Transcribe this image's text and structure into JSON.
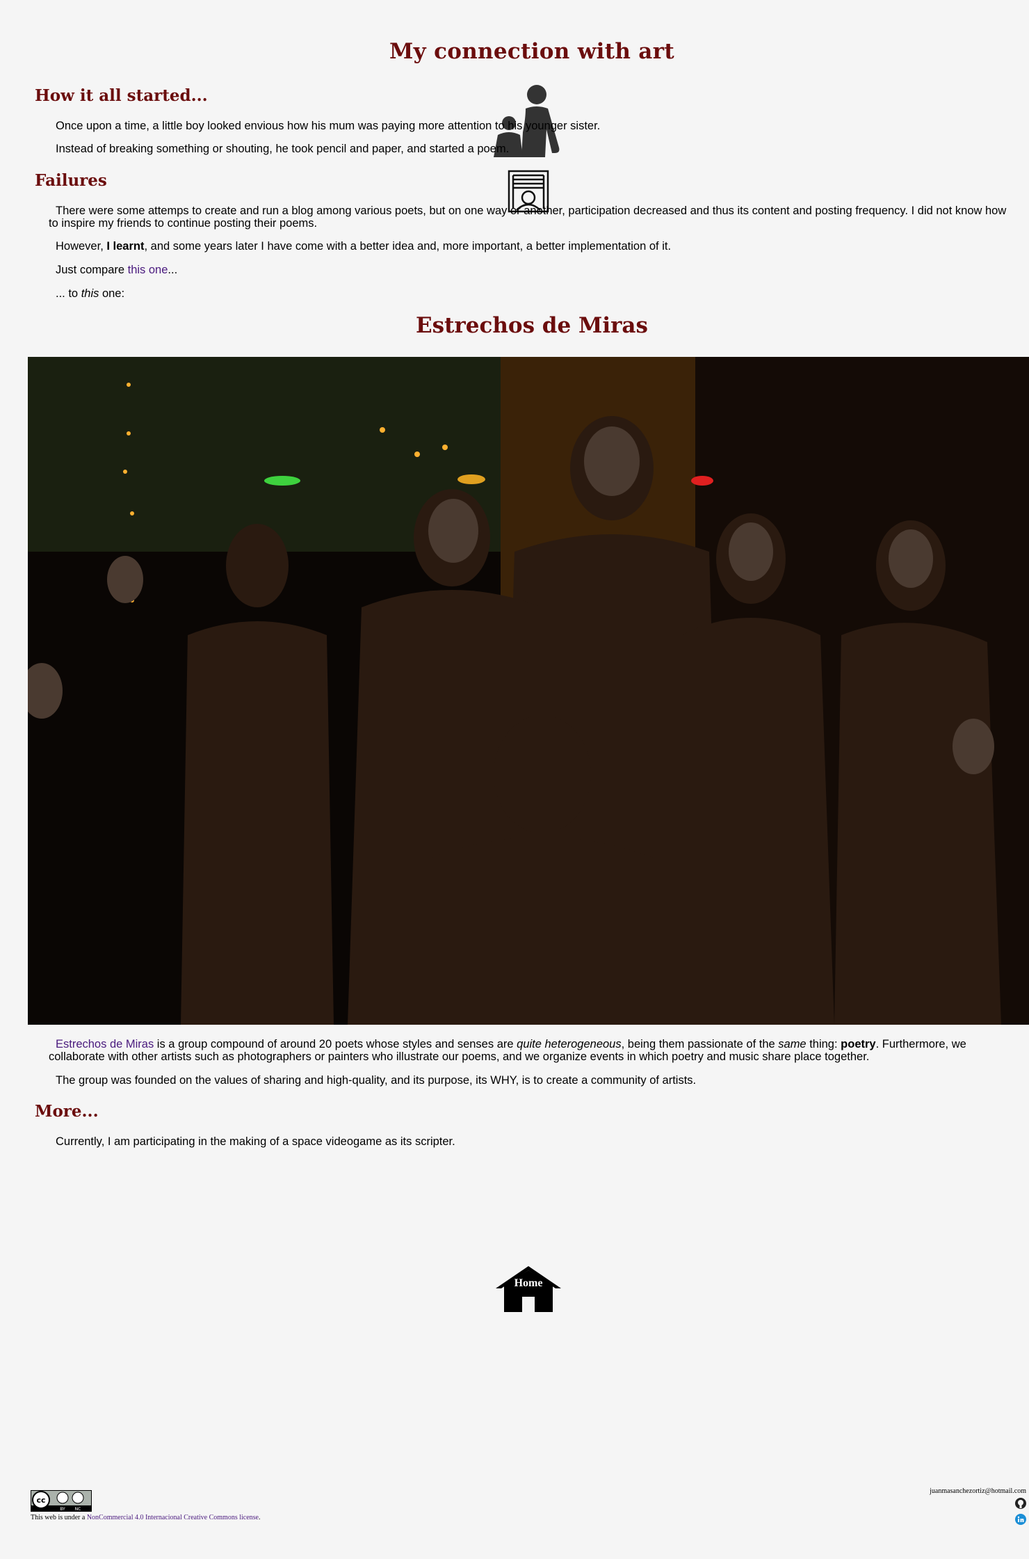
{
  "title": "My connection with art",
  "sections": {
    "started": {
      "heading": "How it all started...",
      "p1": "Once upon a time, a little boy looked envious how his mum was paying more attention to his younger sister.",
      "p2": "Instead of breaking something or shouting, he took pencil and paper, and started a poem."
    },
    "failures": {
      "heading": "Failures",
      "p1": "There were some attemps to create and run a blog among various poets, but on one way or another, participation decreased and thus its content and posting frequency. I did not know how to inspire my friends to continue posting their poems.",
      "p2_a": "However, ",
      "p2_bold": "I learnt",
      "p2_b": ", and some years later I have come with a better idea and, more important, a better implementation of it.",
      "p3_a": "Just compare ",
      "p3_link": "this one",
      "p3_b": "...",
      "p4_a": "... to ",
      "p4_em": "this",
      "p4_b": " one:"
    },
    "estrechos": {
      "heading": "Estrechos de Miras",
      "p1_link": "Estrechos de Miras",
      "p1_a": " is a group compound of around 20 poets whose styles and senses are ",
      "p1_em1": "quite heterogeneous",
      "p1_b": ", being them passionate of the ",
      "p1_em2": "same",
      "p1_c": " thing: ",
      "p1_bold": "poetry",
      "p1_d": ". Furthermore, we collaborate with other artists such as photographers or painters who illustrate our poems, and we organize events in which poetry and music share place together.",
      "p2": "The group was founded on the values of sharing and high-quality, and its purpose, its WHY, is to create a community of artists."
    },
    "more": {
      "heading": "More...",
      "p1": "Currently, I am participating in the making of a space videogame as its scripter."
    }
  },
  "home_label": "Home",
  "footer": {
    "license_prefix": "This web is under a ",
    "license_link": "NonCommercial 4.0 Internacional Creative Commons license",
    "license_suffix": ".",
    "badge_cc": "cc",
    "badge_by": "BY",
    "badge_nc": "NC",
    "email": "juanmasanchezortiz@hotmail.com"
  },
  "icons": [
    "mother-child-icon",
    "framed-portrait-icon",
    "home-icon",
    "github-icon",
    "linkedin-icon",
    "cc-by-nc-badge"
  ],
  "colors": {
    "heading": "#6b0d0d",
    "link": "#4a1a7e",
    "background": "#f5f5f5",
    "linkedin": "#1b8ed6"
  }
}
